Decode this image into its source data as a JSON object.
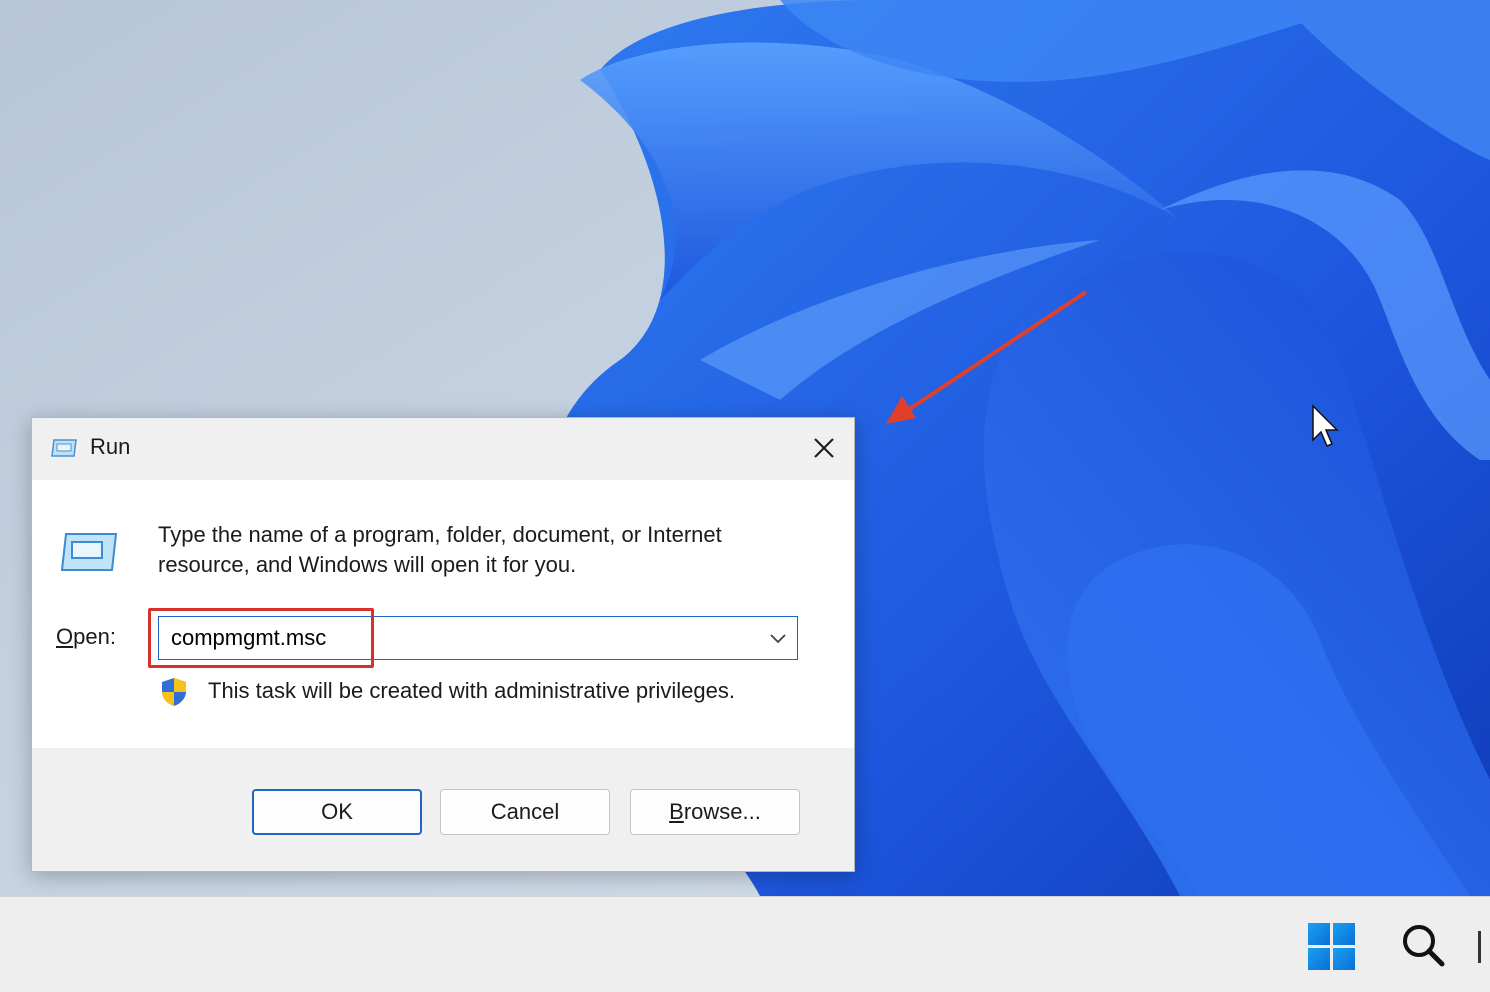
{
  "dialog": {
    "title": "Run",
    "description": "Type the name of a program, folder, document, or Internet resource, and Windows will open it for you.",
    "open_label_accel": "O",
    "open_label_rest": "pen:",
    "open_value": "compmgmt.msc",
    "admin_note": "This task will be created with administrative privileges.",
    "buttons": {
      "ok": "OK",
      "cancel": "Cancel",
      "browse_accel": "B",
      "browse_rest": "rowse..."
    }
  },
  "icons": {
    "title": "run-icon",
    "big": "run-icon",
    "close": "close-icon",
    "dropdown": "chevron-down-icon",
    "shield": "uac-shield-icon",
    "start": "windows-logo-icon",
    "search": "search-icon",
    "cursor": "mouse-cursor-icon",
    "arrow": "red-annotation-arrow"
  },
  "colors": {
    "accent": "#1f65c8",
    "annotation": "#d9302c",
    "wallpaper_blue": "#1f5fe0",
    "dialog_bg": "#f0f0f0",
    "taskbar_bg": "#eeeeee"
  }
}
